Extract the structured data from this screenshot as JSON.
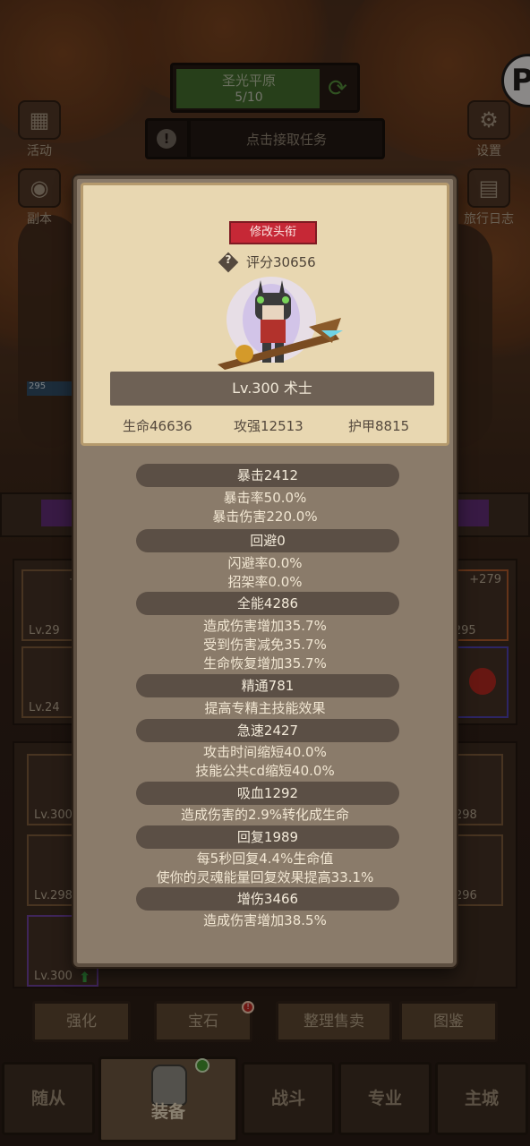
{
  "hud": {
    "zone_name": "圣光平原",
    "zone_progress": "5/10",
    "task_label": "点击接取任务",
    "left_buttons": [
      {
        "label": "活动",
        "icon": "calendar-icon"
      },
      {
        "label": "副本",
        "icon": "portal-icon"
      }
    ],
    "right_buttons": [
      {
        "label": "设置",
        "icon": "gear-icon"
      },
      {
        "label": "旅行日志",
        "icon": "book-icon"
      }
    ],
    "badge": "P"
  },
  "background": {
    "slots_left": [
      {
        "plus": "+2",
        "level": "Lv.29"
      },
      {
        "plus": "",
        "level": "Lv.24"
      }
    ],
    "slots_right": [
      {
        "plus": "+279",
        "level": "v.295"
      },
      {
        "plus": "",
        "level": ""
      }
    ],
    "lower_slots_left": [
      {
        "level": "Lv.300"
      },
      {
        "level": "Lv.298"
      },
      {
        "level": "Lv.300"
      }
    ],
    "lower_slots_right": [
      {
        "level": "298"
      },
      {
        "level": "296"
      }
    ],
    "side_level": "295"
  },
  "actions": [
    "强化",
    "宝石",
    "整理售卖",
    "图鉴"
  ],
  "nav": [
    "随从",
    "装备",
    "战斗",
    "专业",
    "主城"
  ],
  "popup": {
    "title_button": "修改头衔",
    "score": "评分30656",
    "level_class": "Lv.300 术士",
    "base_stats": [
      "生命46636",
      "攻强12513",
      "护甲8815"
    ],
    "stats": [
      {
        "header": "暴击2412",
        "lines": [
          "暴击率50.0%",
          "暴击伤害220.0%"
        ]
      },
      {
        "header": "回避0",
        "lines": [
          "闪避率0.0%",
          "招架率0.0%"
        ]
      },
      {
        "header": "全能4286",
        "lines": [
          "造成伤害增加35.7%",
          "受到伤害减免35.7%",
          "生命恢复增加35.7%"
        ]
      },
      {
        "header": "精通781",
        "lines": [
          "提高专精主技能效果"
        ]
      },
      {
        "header": "急速2427",
        "lines": [
          "攻击时间缩短40.0%",
          "技能公共cd缩短40.0%"
        ]
      },
      {
        "header": "吸血1292",
        "lines": [
          "造成伤害的2.9%转化成生命"
        ]
      },
      {
        "header": "回复1989",
        "lines": [
          "每5秒回复4.4%生命值",
          "使你的灵魂能量回复效果提高33.1%"
        ]
      },
      {
        "header": "增伤3466",
        "lines": [
          "造成伤害增加38.5%"
        ]
      }
    ]
  },
  "colors": {
    "title_button": "#c62836",
    "popup_parchment": "#e8d7b1",
    "popup_body": "#8a7b6a",
    "stat_header": "#5b4f45"
  }
}
